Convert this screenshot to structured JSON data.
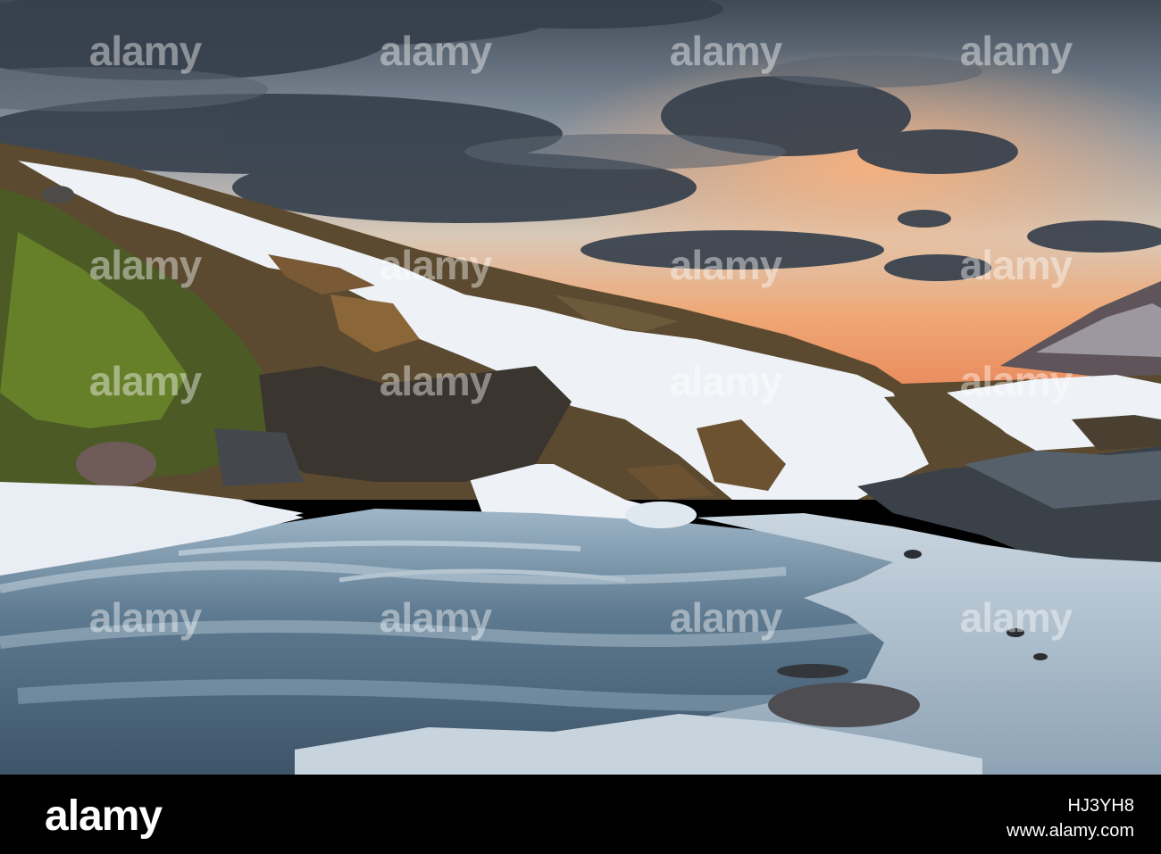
{
  "watermark": {
    "brand": "alamy"
  },
  "footer": {
    "logo_text": "alamy",
    "image_id": "HJ3YH8",
    "alamy_id_line": "www.alamy.com"
  },
  "colors": {
    "sky_top": "#4b5966",
    "sunset": "#f0a06a",
    "snow": "#eef2f6",
    "moss": "#6a7a3a",
    "water": "#6d8aa3",
    "footer_bg": "#000000"
  }
}
